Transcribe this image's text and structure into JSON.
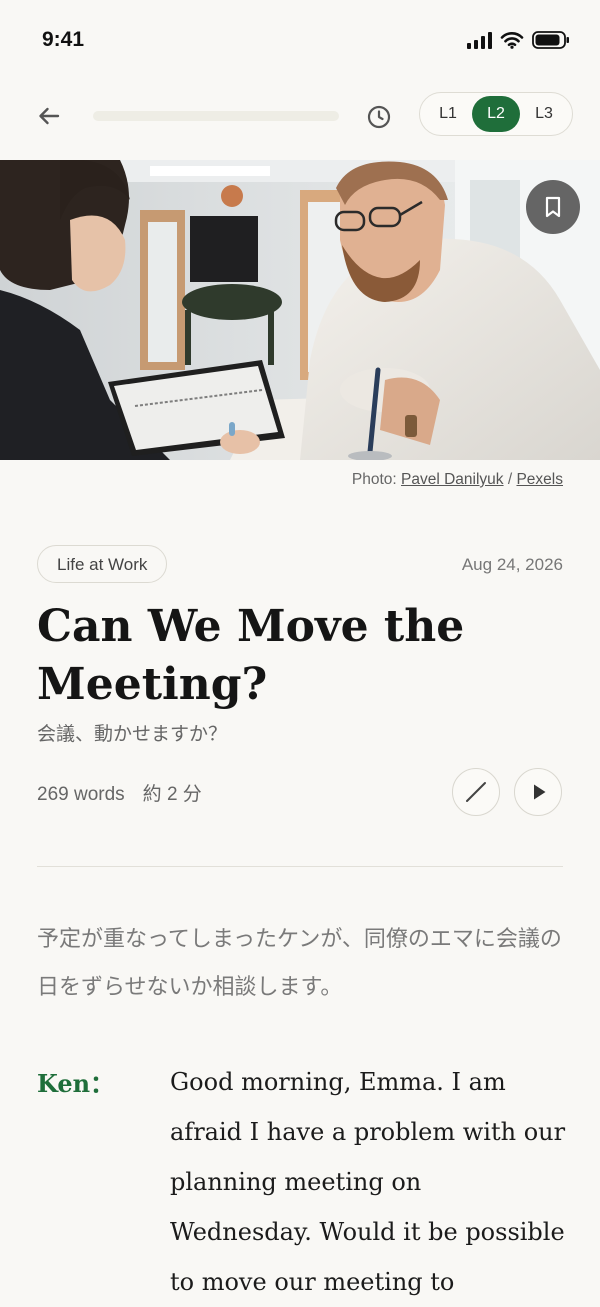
{
  "status_bar": {
    "time": "9:41"
  },
  "reading_progress": 0,
  "levels": [
    "L1",
    "L2",
    "L3"
  ],
  "active_level": "L2",
  "photo_credit": {
    "prefix": "Photo: ",
    "author": "Pavel Danilyuk",
    "separator": " / ",
    "source": "Pexels"
  },
  "article": {
    "category": "Life at Work",
    "date": "Aug 24, 2026",
    "title": "Can We Move the Meeting?",
    "subtitle": "会議、動かせますか？",
    "word_count": "269 words",
    "read_time": "約 2 分",
    "intro": "予定が重なってしまったケンが、同僚のエマに会議の日をずらせないか相談します。",
    "dialogue": [
      {
        "speaker": "Ken：",
        "text": "Good morning, Emma. I am afraid I have a problem with our planning meeting on Wednesday. Would it be possible to move our meeting to"
      }
    ]
  },
  "icons": {
    "back": "arrow-left-icon",
    "history": "clock-icon",
    "bookmark": "bookmark-icon",
    "highlight": "slash-icon",
    "play": "play-icon"
  },
  "colors": {
    "accent": "#1f6e3a",
    "background": "#f9f8f5"
  }
}
